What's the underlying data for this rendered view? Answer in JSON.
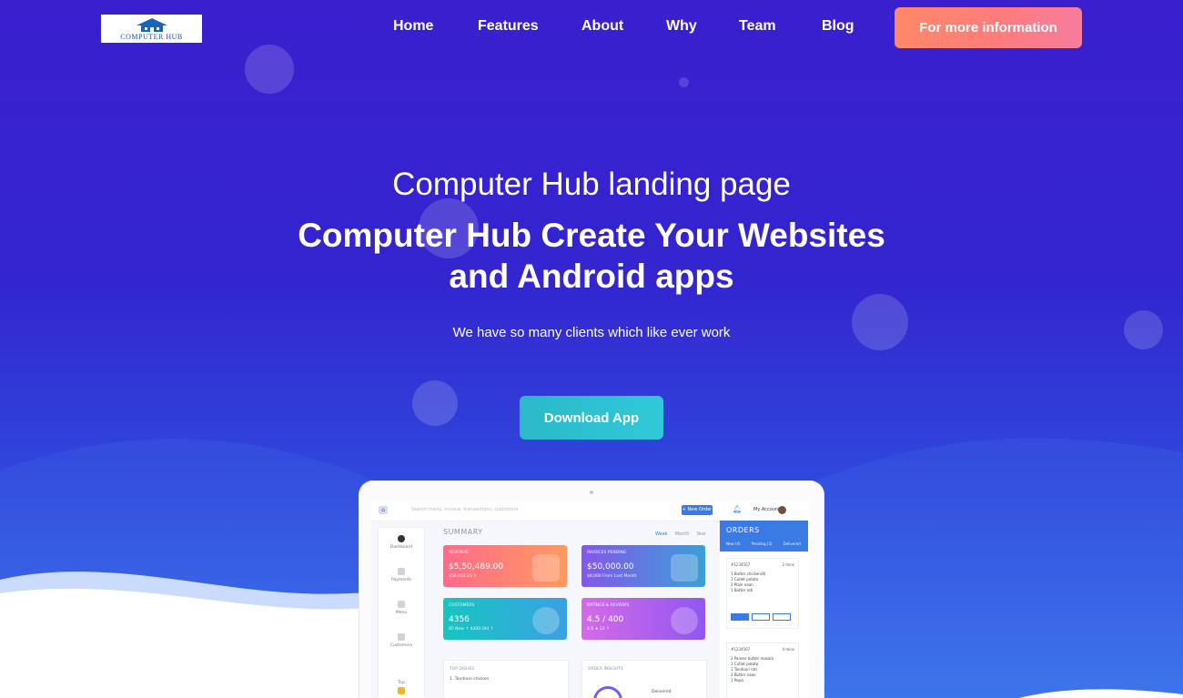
{
  "header": {
    "logo_text": "COMPUTER HUB",
    "nav": [
      "Home",
      "Features",
      "About",
      "Why",
      "Team",
      "Blog"
    ],
    "cta_label": "For more information"
  },
  "hero": {
    "eyebrow": "Computer Hub landing page",
    "headline": "Computer Hub Create Your Websites and Android apps",
    "subtitle": "We have so many clients which like ever work",
    "download_label": "Download App"
  },
  "dashboard": {
    "search_placeholder": "Search menu, invoice, transactions, customers",
    "new_button": "+ New Order",
    "account": "My Account",
    "sidebar": [
      "Dashboard",
      "Payments",
      "Menu",
      "Customers",
      "Top"
    ],
    "summary_title": "SUMMARY",
    "periods": [
      "Week",
      "Month",
      "Year"
    ],
    "cards": [
      {
        "label": "REVENUE",
        "value": "$5,50,489.00",
        "sub": "$50,932.25 ↑"
      },
      {
        "label": "INVOICES PENDING",
        "value": "$50,000.00",
        "sub": "$8,000 From Last Month"
      },
      {
        "label": "CUSTOMERS",
        "value": "4356",
        "sub": "85 New ↑     4300 Old ↑"
      },
      {
        "label": "RATINGS & REVIEWS",
        "value": "4.5 / 400",
        "sub": "4.5 ★          22 ↑"
      }
    ],
    "top_dishes_title": "TOP DISHES",
    "top_dish_row": "1. Tandoori chicken",
    "order_insights_title": "ORDER INSIGHTS",
    "order_insights_row": "Delivered",
    "orders_title": "ORDERS",
    "orders_tabs": [
      "New (4)",
      "Pending (3)",
      "Delivered"
    ],
    "order_cards": [
      {
        "id": "#1234567",
        "time": "2 mins",
        "items": "1 Butter chicken(8)\n1 Cutlet potato\n2 Plain naan\n1 Butter roti"
      },
      {
        "id": "#1234567",
        "time": "4 mins",
        "items": "2 Paneer butter masala\n1 Cutlet potato\n1 Tandoori roti\n2 Butter naan\n1 Pepsi"
      }
    ]
  },
  "colors": {
    "bg_top": "#3a1fcf",
    "bg_bottom": "#3a74ea",
    "cta": "#ff7f7b",
    "download": "#2fc1d0"
  }
}
